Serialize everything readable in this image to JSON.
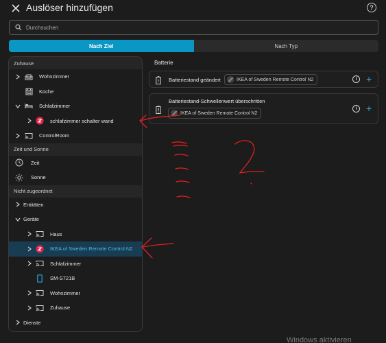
{
  "header": {
    "title": "Auslöser hinzufügen",
    "close_icon": "close-icon",
    "help_icon": "help-icon",
    "help_glyph": "?"
  },
  "search": {
    "placeholder": "Durchsuchen"
  },
  "tabs": [
    {
      "label": "Nach Ziel",
      "active": true
    },
    {
      "label": "Nach Typ",
      "active": false
    }
  ],
  "left_panel": {
    "section_zuhause": "Zuhause",
    "zuhause_items": [
      {
        "label": "Wohnzimmer",
        "icon": "sofa-icon"
      },
      {
        "label": "Küche",
        "icon": "stove-icon"
      },
      {
        "label": "Schlafzimmer",
        "icon": "bed-icon"
      },
      {
        "label": "schlafzimmer schalter wand",
        "icon": "device-icon"
      },
      {
        "label": "ControlRoom",
        "icon": "cast-icon"
      }
    ],
    "section_zeit": "Zeit und Sonne",
    "zeit_items": [
      {
        "label": "Zeit",
        "icon": "clock-icon"
      },
      {
        "label": "Sonne",
        "icon": "sun-icon"
      }
    ],
    "section_nicht": "Nicht zugeordnet",
    "nicht_items": [
      {
        "label": "Entitäten"
      },
      {
        "label": "Geräte"
      }
    ],
    "geraete_items": [
      {
        "label": "Haus",
        "icon": "cast-icon"
      },
      {
        "label": "IKEA of Sweden Remote Control N2",
        "icon": "device-icon",
        "selected": true
      },
      {
        "label": "Schlafzimmer",
        "icon": "cast-icon"
      },
      {
        "label": "SM-S721B",
        "icon": "phone-icon"
      },
      {
        "label": "Wohnzimmer",
        "icon": "cast-icon"
      },
      {
        "label": "Zuhause",
        "icon": "cast-icon"
      }
    ],
    "dienste": "Dienste"
  },
  "right_panel": {
    "title": "Batterie",
    "cards": [
      {
        "title": "Batteriestand geändert",
        "chip": "IKEA of Sweden Remote Control N2",
        "icon": "battery-unknown-icon"
      },
      {
        "title": "Batteriestand-Schwellenwert überschritten",
        "chip": "IKEA of Sweden Remote Control N2",
        "icon": "battery-alert-icon"
      }
    ],
    "info_glyph": "i",
    "plus_glyph": "+"
  },
  "watermark": "Windows aktivieren",
  "colors": {
    "accent": "#0b97c4",
    "annotation": "#e02020",
    "device_red": "#e0254a"
  }
}
